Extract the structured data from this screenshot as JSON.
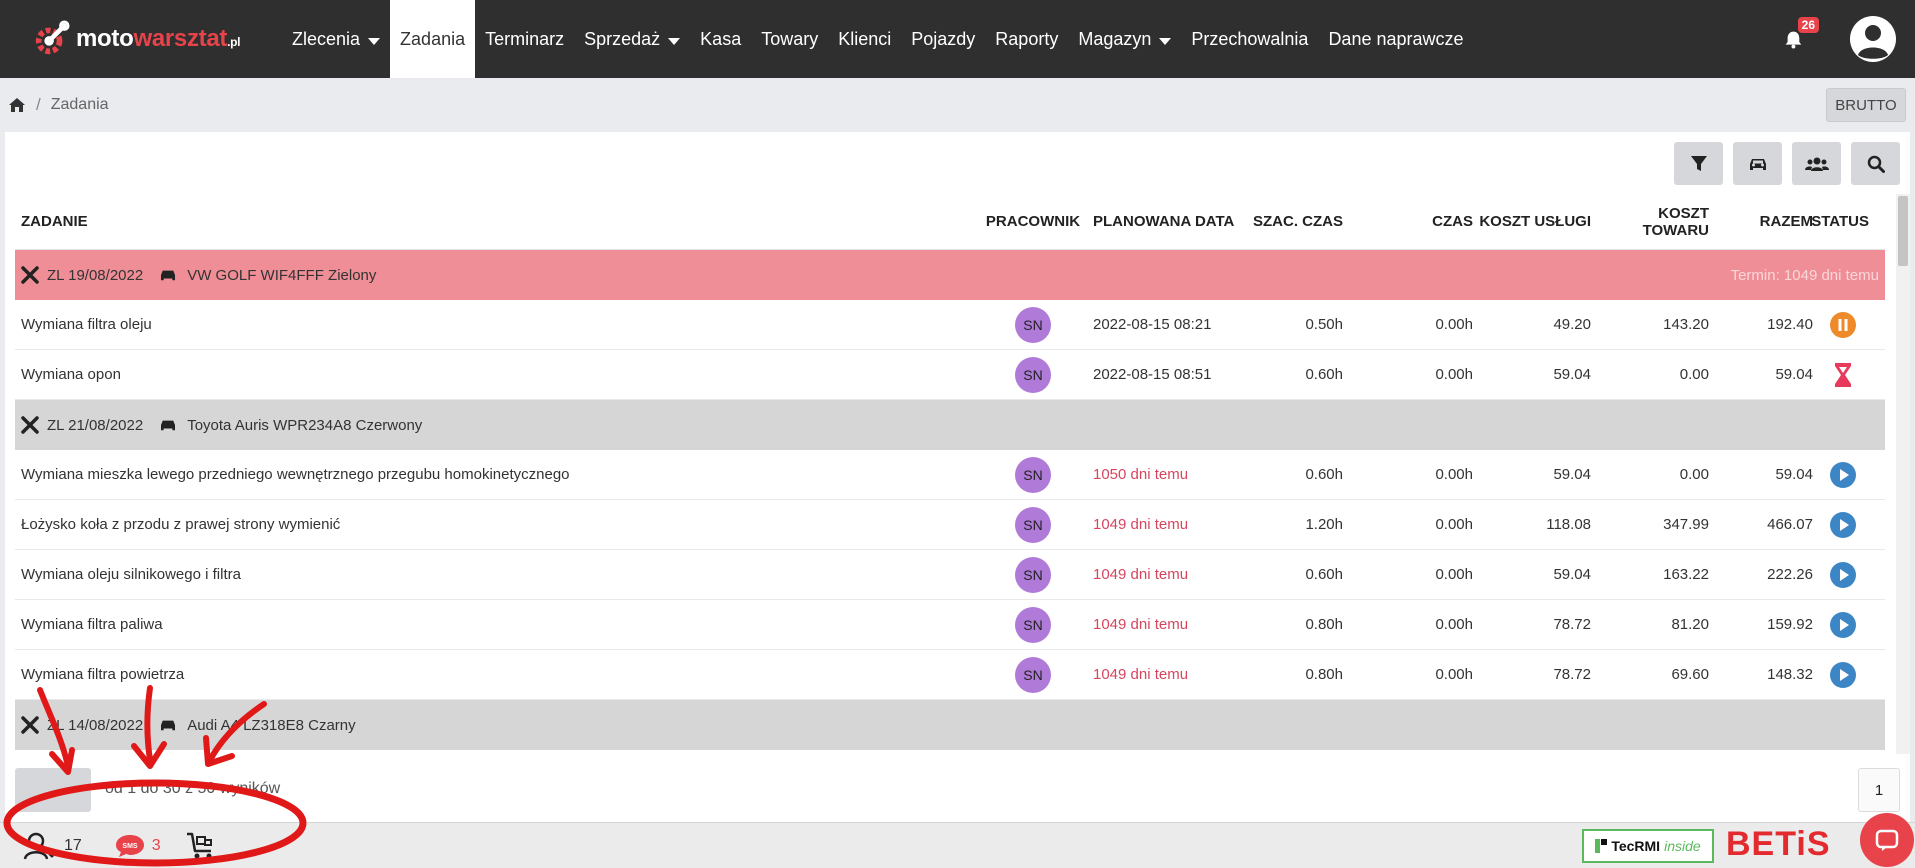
{
  "app": {
    "logo": {
      "moto": "moto",
      "warsztat": "warsztat",
      "pl": ".pl"
    }
  },
  "nav": {
    "items": [
      {
        "label": "Zlecenia",
        "dropdown": true,
        "active": false
      },
      {
        "label": "Zadania",
        "dropdown": false,
        "active": true
      },
      {
        "label": "Terminarz",
        "dropdown": false,
        "active": false
      },
      {
        "label": "Sprzedaż",
        "dropdown": true,
        "active": false
      },
      {
        "label": "Kasa",
        "dropdown": false,
        "active": false
      },
      {
        "label": "Towary",
        "dropdown": false,
        "active": false
      },
      {
        "label": "Klienci",
        "dropdown": false,
        "active": false
      },
      {
        "label": "Pojazdy",
        "dropdown": false,
        "active": false
      },
      {
        "label": "Raporty",
        "dropdown": false,
        "active": false
      },
      {
        "label": "Magazyn",
        "dropdown": true,
        "active": false
      },
      {
        "label": "Przechowalnia",
        "dropdown": false,
        "active": false
      },
      {
        "label": "Dane naprawcze",
        "dropdown": false,
        "active": false
      }
    ],
    "notifications_count": "26"
  },
  "breadcrumb": {
    "separator": "/",
    "current": "Zadania"
  },
  "price_mode": "BRUTTO",
  "table": {
    "headers": {
      "task": "ZADANIE",
      "employee": "PRACOWNIK",
      "date": "PLANOWANA DATA",
      "est": "SZAC. CZAS",
      "time": "CZAS",
      "service_cost": "KOSZT USŁUGI",
      "goods_cost": "KOSZT TOWARU",
      "total": "RAZEM",
      "status": "STATUS"
    },
    "groups": [
      {
        "order": "ZL 19/08/2022",
        "vehicle": "VW GOLF WIF4FFF Zielony",
        "urgent": true,
        "term": "Termin: 1049 dni temu",
        "tasks": [
          {
            "name": "Wymiana filtra oleju",
            "employee": "SN",
            "date": "2022-08-15 08:21",
            "overdue": false,
            "est": "0.50h",
            "time": "0.00h",
            "service_cost": "49.20",
            "goods_cost": "143.20",
            "total": "192.40",
            "status": "paused"
          },
          {
            "name": "Wymiana opon",
            "employee": "SN",
            "date": "2022-08-15 08:51",
            "overdue": false,
            "est": "0.60h",
            "time": "0.00h",
            "service_cost": "59.04",
            "goods_cost": "0.00",
            "total": "59.04",
            "status": "waiting"
          }
        ]
      },
      {
        "order": "ZL 21/08/2022",
        "vehicle": "Toyota Auris WPR234A8 Czerwony",
        "urgent": false,
        "term": "",
        "tasks": [
          {
            "name": "Wymiana mieszka lewego przedniego wewnętrznego przegubu homokinetycznego",
            "employee": "SN",
            "date": "1050 dni temu",
            "overdue": true,
            "est": "0.60h",
            "time": "0.00h",
            "service_cost": "59.04",
            "goods_cost": "0.00",
            "total": "59.04",
            "status": "play"
          },
          {
            "name": "Łożysko koła z przodu z prawej strony wymienić",
            "employee": "SN",
            "date": "1049 dni temu",
            "overdue": true,
            "est": "1.20h",
            "time": "0.00h",
            "service_cost": "118.08",
            "goods_cost": "347.99",
            "total": "466.07",
            "status": "play"
          },
          {
            "name": "Wymiana oleju silnikowego i filtra",
            "employee": "SN",
            "date": "1049 dni temu",
            "overdue": true,
            "est": "0.60h",
            "time": "0.00h",
            "service_cost": "59.04",
            "goods_cost": "163.22",
            "total": "222.26",
            "status": "play"
          },
          {
            "name": "Wymiana filtra paliwa",
            "employee": "SN",
            "date": "1049 dni temu",
            "overdue": true,
            "est": "0.80h",
            "time": "0.00h",
            "service_cost": "78.72",
            "goods_cost": "81.20",
            "total": "159.92",
            "status": "play"
          },
          {
            "name": "Wymiana filtra powietrza",
            "employee": "SN",
            "date": "1049 dni temu",
            "overdue": true,
            "est": "0.80h",
            "time": "0.00h",
            "service_cost": "78.72",
            "goods_cost": "69.60",
            "total": "148.32",
            "status": "play"
          }
        ]
      },
      {
        "order": "ZL 14/08/2022",
        "vehicle": "Audi A4 LZ318E8 Czarny",
        "urgent": false,
        "term": "",
        "tasks": []
      }
    ]
  },
  "pagination": {
    "info": "od 1 do 30 z 50 wyników",
    "page": "1"
  },
  "footer": {
    "clients_count": "17",
    "sms_count": "3",
    "tecrmi_main": "TecRMI",
    "tecrmi_inside": "inside",
    "betis": "BETiS"
  },
  "colors": {
    "navbar": "#2f2f2f",
    "accent_red": "#e8434a",
    "urgent_row": "#ef8e96",
    "group_row": "#d6d6d6",
    "employee_badge": "#b07ad9",
    "status_play": "#3d86c6",
    "status_paused": "#ef8a2b",
    "status_waiting": "#e83a5a"
  }
}
